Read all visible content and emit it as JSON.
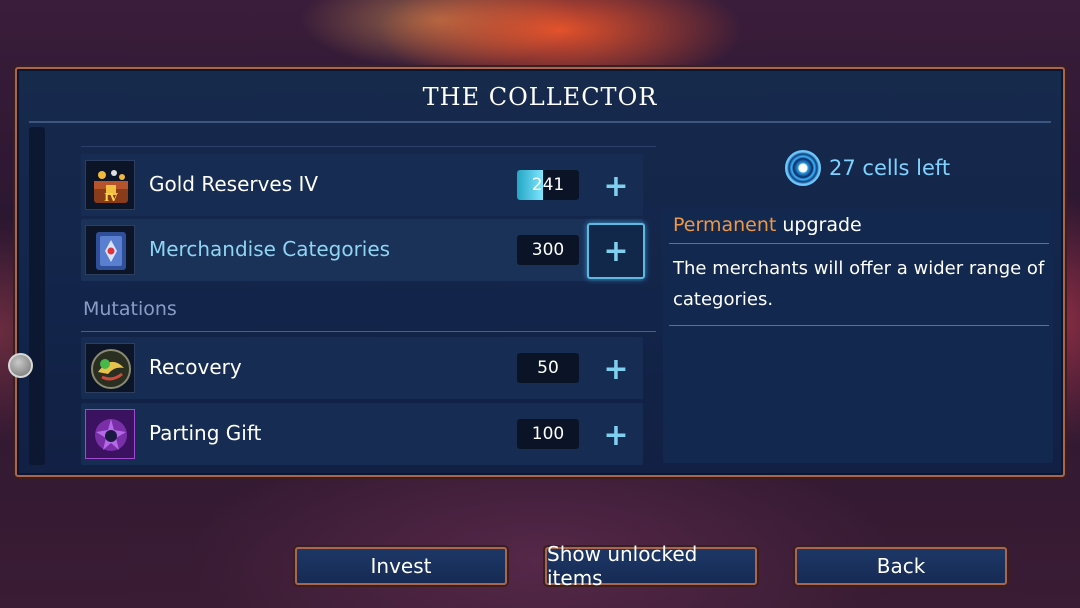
{
  "title": "THE COLLECTOR",
  "cells": {
    "count_label": "27 cells left",
    "icon": "cell-icon"
  },
  "upgrades": [
    {
      "label": "Gold Reserves IV",
      "cost": "241",
      "progress": 0.42,
      "icon": "gold-chest-icon"
    },
    {
      "label": "Merchandise Categories",
      "cost": "300",
      "icon": "merchant-card-icon",
      "selected": true
    }
  ],
  "mutations_section": "Mutations",
  "mutations": [
    {
      "label": "Recovery",
      "cost": "50",
      "icon": "recovery-icon"
    },
    {
      "label": "Parting Gift",
      "cost": "100",
      "icon": "parting-gift-icon"
    }
  ],
  "plus_label": "+",
  "details": {
    "highlight": "Permanent",
    "kind": " upgrade",
    "description": "The merchants will offer a wider range of categories."
  },
  "buttons": {
    "invest": "Invest",
    "show_unlocked": "Show unlocked items",
    "back": "Back"
  },
  "colors": {
    "accent_orange": "#ee9845",
    "accent_cyan": "#7ed2ff",
    "frame_border": "#a9654d"
  }
}
